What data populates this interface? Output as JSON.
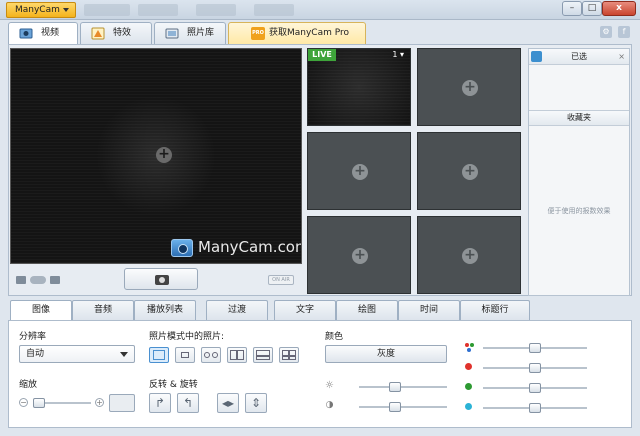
{
  "titlebar": {
    "app_menu": "ManyCam",
    "window_buttons": [
      "minimize-icon",
      "maximize-icon",
      "close-icon"
    ],
    "close_glyph": "x",
    "min_glyph": "–",
    "max_glyph": "□"
  },
  "main_tabs": [
    {
      "label": "视频",
      "icon": "video-icon"
    },
    {
      "label": "特效",
      "icon": "effects-icon"
    },
    {
      "label": "照片库",
      "icon": "gallery-icon"
    },
    {
      "label": "获取ManyCam Pro",
      "icon": "pro-icon",
      "badge": "PRO"
    }
  ],
  "preview": {
    "brand": "ManyCam.com",
    "add_glyph": "+",
    "on_air": "ON AIR"
  },
  "sources": {
    "live_label": "LIVE",
    "live_number": "1 ▾",
    "add_glyph": "+"
  },
  "right_panel": {
    "selected_title": "已选",
    "close_glyph": "×",
    "favorites_title": "收藏夹",
    "hint": "便于使用的报数效果"
  },
  "sub_tabs": [
    "图像",
    "音频",
    "播放列表",
    "过渡",
    "文字",
    "绘图",
    "时间",
    "标题行"
  ],
  "settings": {
    "resolution_label": "分辨率",
    "resolution_value": "自动",
    "photo_mode_label": "照片模式中的照片:",
    "color_label": "颜色",
    "grayscale_button": "灰度",
    "zoom_label": "缩放",
    "flip_rotate_label": "反转 & 旋转",
    "zoom_minus": "−",
    "zoom_plus": "+"
  },
  "colors": {
    "accent": "#4a90d0",
    "live_green": "#3ea43a",
    "menu_orange": "#f4b31c"
  }
}
